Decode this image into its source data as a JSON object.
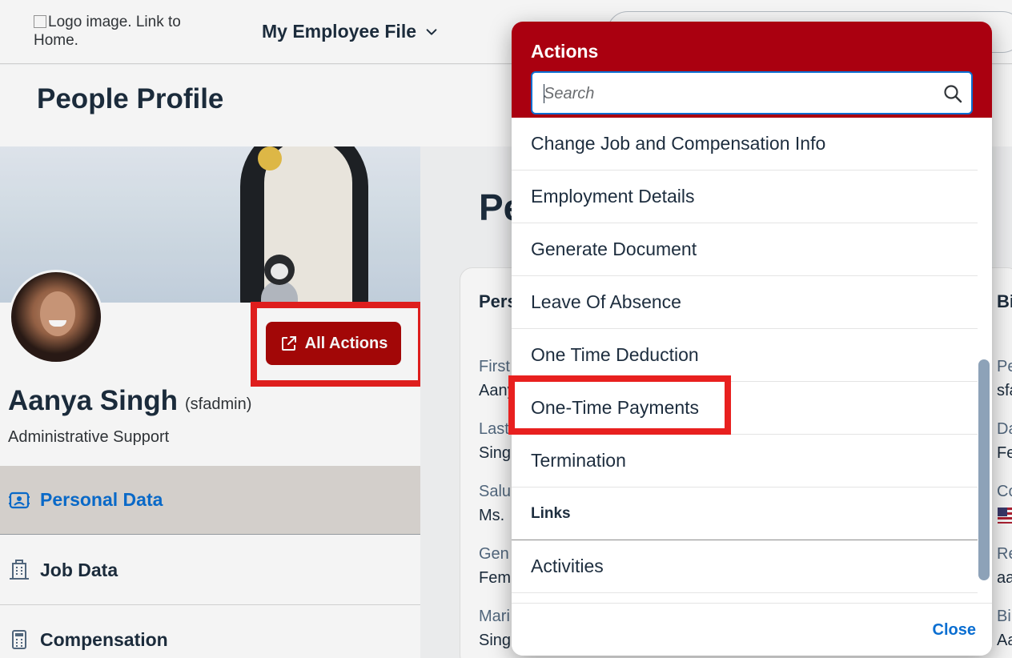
{
  "shell": {
    "logo_alt": "Logo image. Link to Home.",
    "module": "My Employee File"
  },
  "page": {
    "title": "People Profile"
  },
  "profile": {
    "name": "Aanya Singh",
    "username": "(sfadmin)",
    "job_title": "Administrative Support",
    "all_actions_label": "All Actions"
  },
  "nav": {
    "items": [
      {
        "label": "Personal Data",
        "icon": "profile-card-icon",
        "selected": true
      },
      {
        "label": "Job Data",
        "icon": "building-icon",
        "selected": false
      },
      {
        "label": "Compensation",
        "icon": "calculator-icon",
        "selected": false
      }
    ]
  },
  "section": {
    "heading": "Pe",
    "card_title": "Pers",
    "right_card_title": "Bi",
    "fields": [
      {
        "label": "First",
        "value": "Aany"
      },
      {
        "label": "Last",
        "value": "Sing"
      },
      {
        "label": "Salu",
        "value": "Ms."
      },
      {
        "label": "Gen",
        "value": "Fem"
      },
      {
        "label": "Mari",
        "value": "Sing"
      }
    ],
    "right_fields": [
      {
        "label": "Pe",
        "value": "sfa"
      },
      {
        "label": "Da",
        "value": "Fe"
      },
      {
        "label": "Co",
        "value": ""
      },
      {
        "label": "Re",
        "value": "aa"
      },
      {
        "label": "Bi",
        "value": "Aa"
      }
    ]
  },
  "popover": {
    "title": "Actions",
    "search_placeholder": "Search",
    "items": [
      "Change Job and Compensation Info",
      "Employment Details",
      "Generate Document",
      "Leave Of Absence",
      "One Time Deduction",
      "One-Time Payments",
      "Termination"
    ],
    "links_group": "Links",
    "link_items": [
      "Activities"
    ],
    "close_label": "Close"
  },
  "colors": {
    "brand_red": "#aa0010",
    "accent_blue": "#0a6ed1",
    "highlight_red": "#e8201f"
  }
}
